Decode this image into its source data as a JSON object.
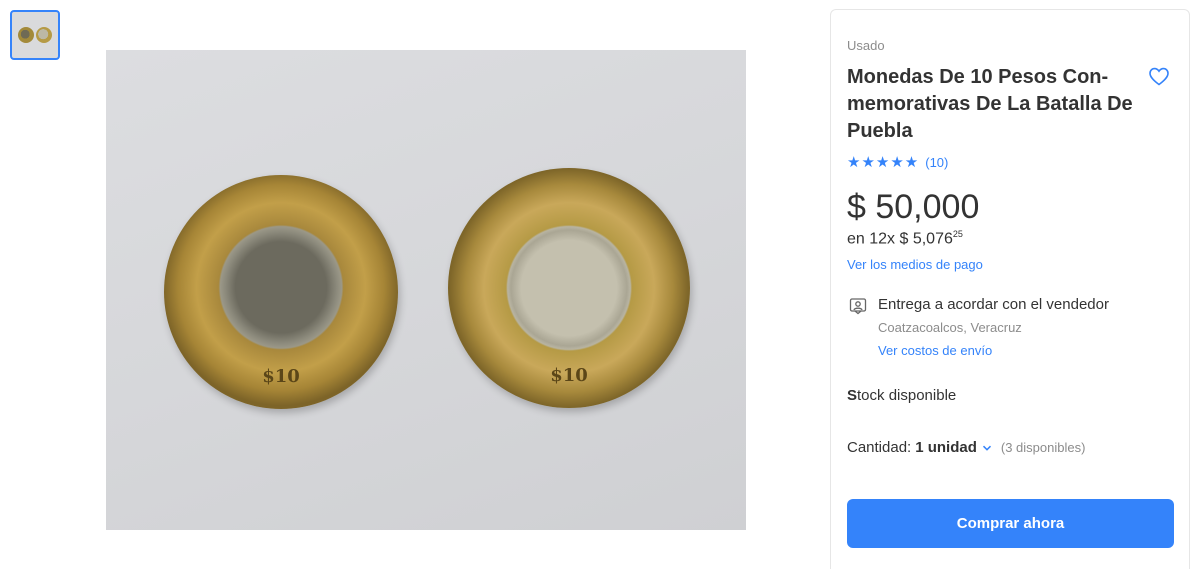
{
  "gallery": {
    "thumbnail_alt": "coins-thumbnail",
    "main_image_alt": "two-commemorative-coins-photo",
    "coin_denomination": "$10"
  },
  "product": {
    "condition": "Usado",
    "title": "Monedas De 10 Pesos Con-memorativas De La Batalla De Puebla",
    "stars": "★★★★★",
    "reviews": "(10)",
    "price": "$ 50,000",
    "installments_prefix": "en 12x $ 5,076",
    "installments_cents": "25",
    "payment_link": "Ver los medios de pago",
    "delivery": "Entrega a acordar con el vendedor",
    "location": "Coatzacoalcos, Veracruz",
    "shipping_link": "Ver costos de envío",
    "stock_first": "S",
    "stock_rest": "tock disponible",
    "quantity_label": "Cantidad:",
    "quantity_value": "1 unidad",
    "quantity_available": "(3 disponibles)",
    "buy_button": "Comprar ahora"
  },
  "colors": {
    "accent": "#3483fa",
    "text": "#333333",
    "muted": "#8c8c8c"
  },
  "icons": {
    "favorite": "heart-icon",
    "delivery": "person-card-icon",
    "quantity": "chevron-down-icon"
  }
}
